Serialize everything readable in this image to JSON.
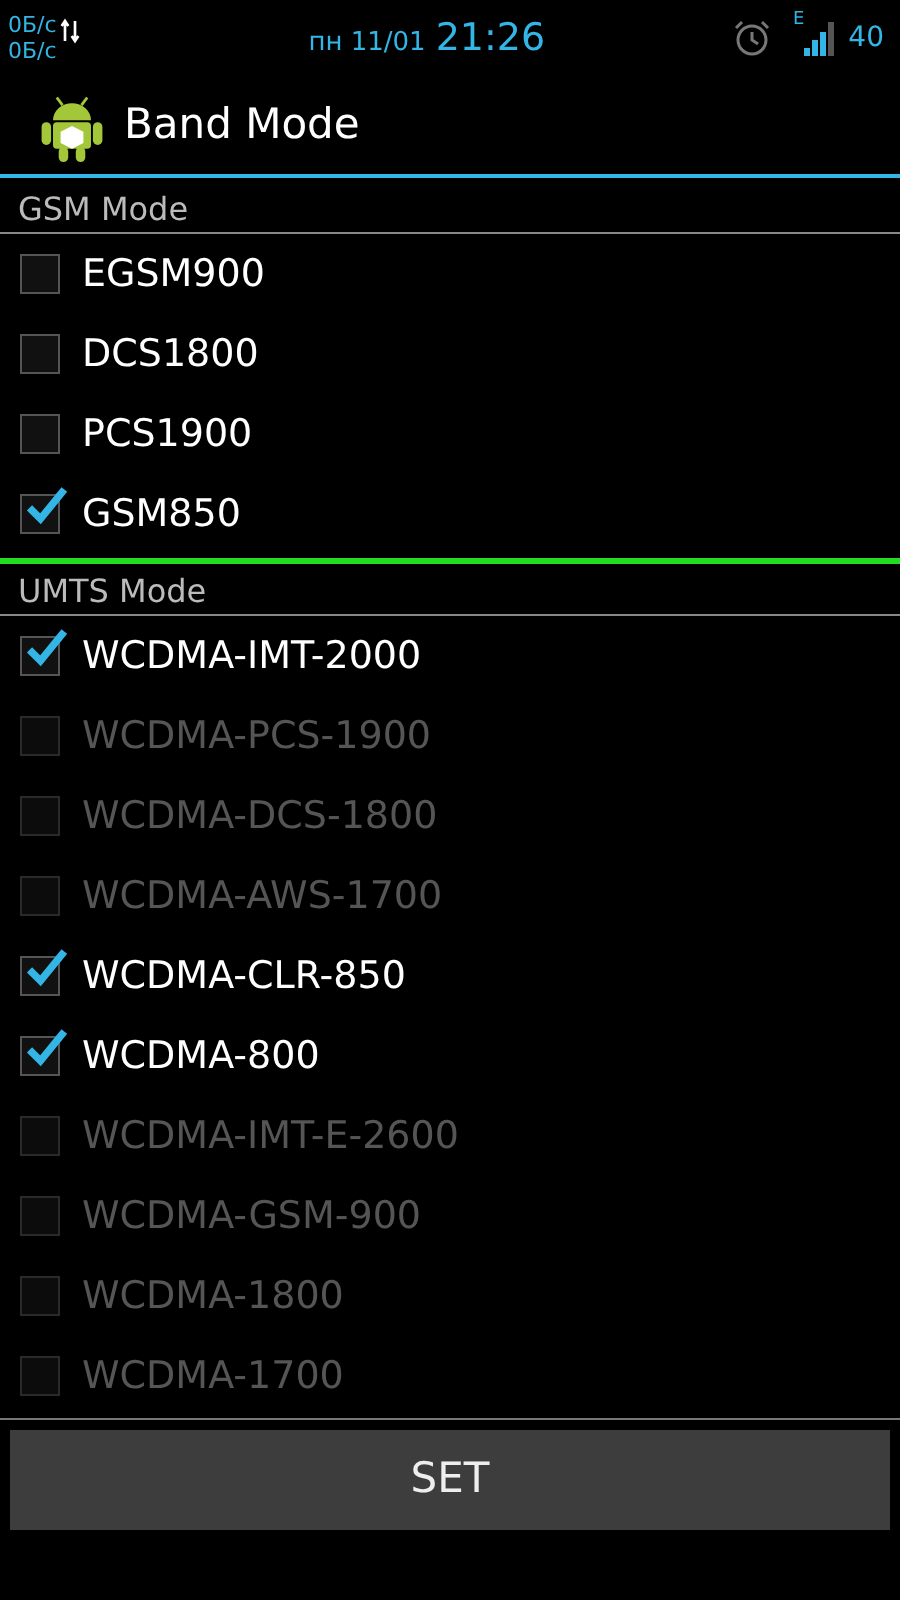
{
  "status_bar": {
    "speed_up": "0Б/с",
    "speed_down": "0Б/с",
    "date": "пн 11/01",
    "time": "21:26",
    "network_type": "E",
    "battery": "40"
  },
  "header": {
    "title": "Band Mode"
  },
  "sections": [
    {
      "title": "GSM Mode",
      "items": [
        {
          "label": "EGSM900",
          "checked": false,
          "disabled": false
        },
        {
          "label": "DCS1800",
          "checked": false,
          "disabled": false
        },
        {
          "label": "PCS1900",
          "checked": false,
          "disabled": false
        },
        {
          "label": "GSM850",
          "checked": true,
          "disabled": false
        }
      ]
    },
    {
      "title": "UMTS Mode",
      "items": [
        {
          "label": "WCDMA-IMT-2000",
          "checked": true,
          "disabled": false
        },
        {
          "label": "WCDMA-PCS-1900",
          "checked": false,
          "disabled": true
        },
        {
          "label": "WCDMA-DCS-1800",
          "checked": false,
          "disabled": true
        },
        {
          "label": "WCDMA-AWS-1700",
          "checked": false,
          "disabled": true
        },
        {
          "label": "WCDMA-CLR-850",
          "checked": true,
          "disabled": false
        },
        {
          "label": "WCDMA-800",
          "checked": true,
          "disabled": false
        },
        {
          "label": "WCDMA-IMT-E-2600",
          "checked": false,
          "disabled": true
        },
        {
          "label": "WCDMA-GSM-900",
          "checked": false,
          "disabled": true
        },
        {
          "label": "WCDMA-1800",
          "checked": false,
          "disabled": true
        },
        {
          "label": "WCDMA-1700",
          "checked": false,
          "disabled": true
        }
      ]
    }
  ],
  "button": {
    "label": "SET"
  }
}
